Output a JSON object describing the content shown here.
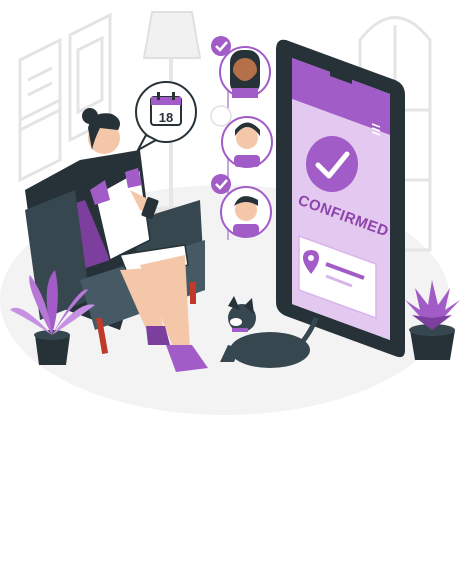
{
  "calendar": {
    "day": "18"
  },
  "phone": {
    "confirm_label": "CONFIRMED"
  },
  "colors": {
    "accent": "#a15cc8",
    "accent_light": "#e3c9ef",
    "dark": "#263238",
    "floor": "#f3f3f3",
    "line": "#e6e6e6"
  },
  "icons": [
    "calendar-icon",
    "checkmark-icon",
    "location-pin-icon",
    "hamburger-menu-icon"
  ]
}
